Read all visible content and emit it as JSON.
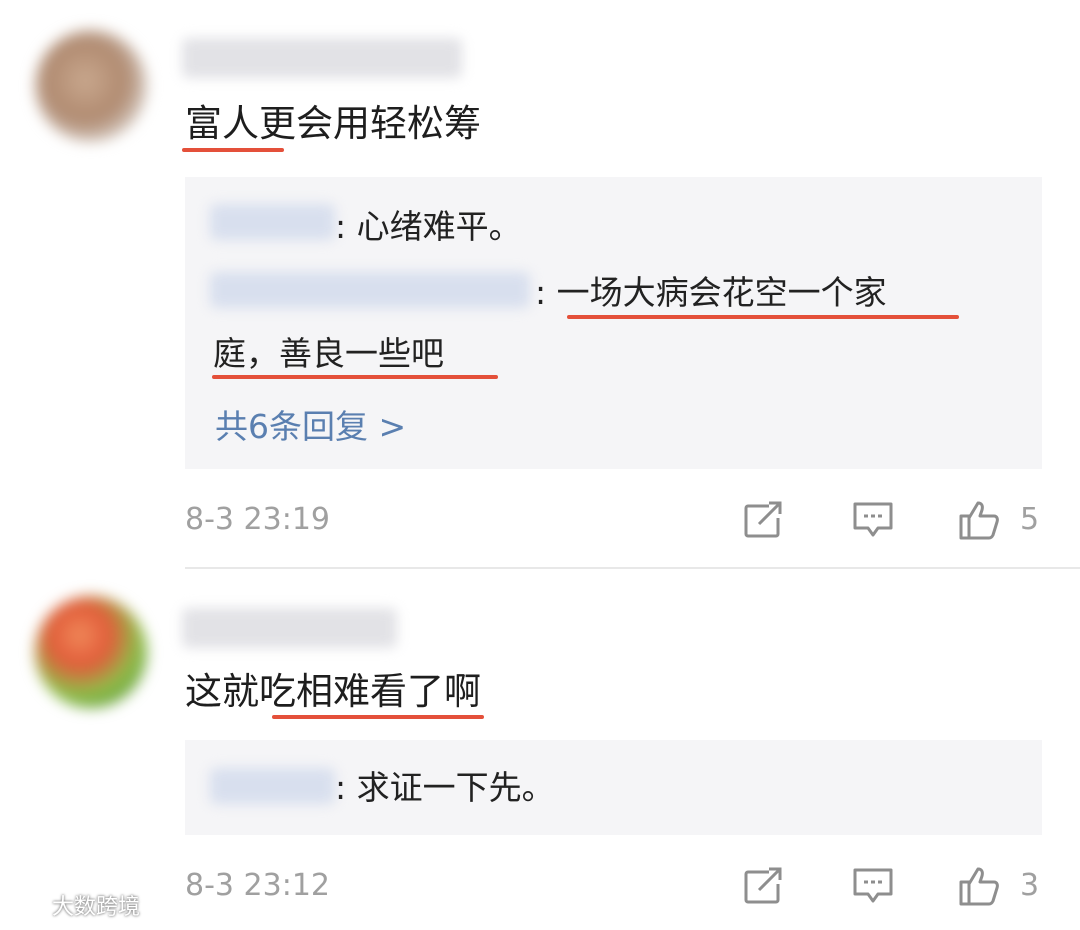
{
  "comments": [
    {
      "text": "富人更会用轻松筹",
      "replies": [
        {
          "text": ": 心绪难平。"
        },
        {
          "text_line1": ": 一场大病会花空一个家",
          "text_line2": "庭，善良一些吧"
        }
      ],
      "more_replies": "共6条回复 >",
      "time": "8-3 23:19",
      "likes": "5"
    },
    {
      "text": "这就吃相难看了啊",
      "replies": [
        {
          "text": ": 求证一下先。"
        }
      ],
      "time": "8-3 23:12",
      "likes": "3"
    }
  ],
  "watermark": "大数跨境",
  "colors": {
    "underline": "#e4503a",
    "link": "#5a7fb0",
    "reply_bg": "#f5f5f7",
    "meta": "#a0a0a0"
  }
}
